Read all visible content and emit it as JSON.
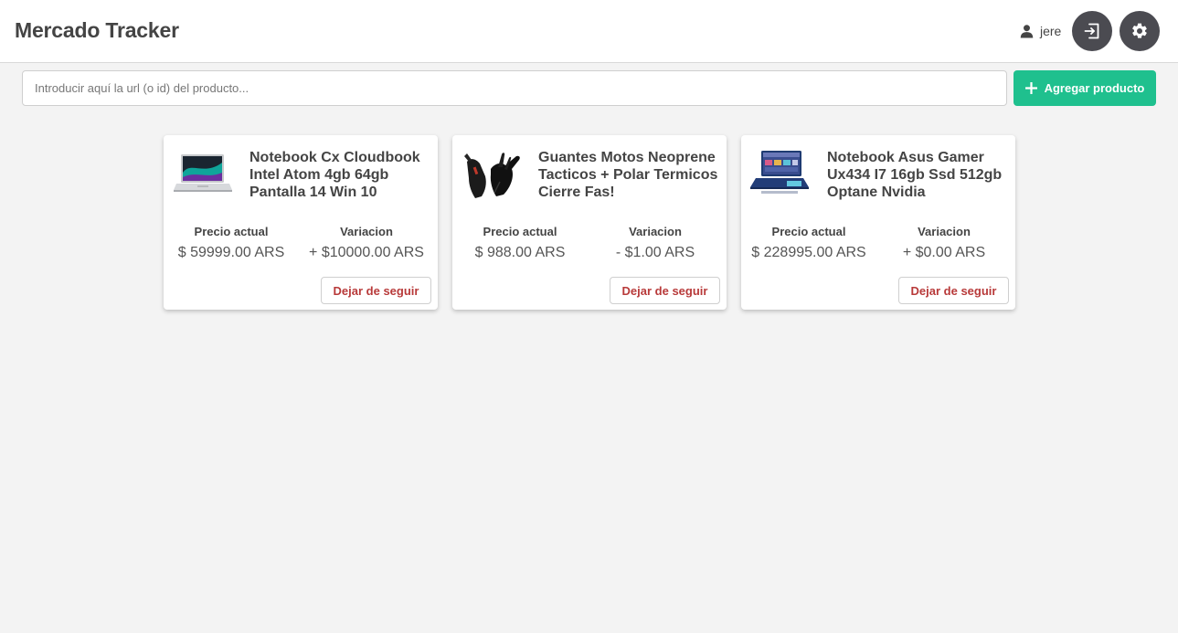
{
  "header": {
    "app_title": "Mercado Tracker",
    "username": "jere",
    "logout_icon": "logout-icon",
    "settings_icon": "gear-icon"
  },
  "search": {
    "placeholder": "Introducir aquí la url (o id) del producto...",
    "value": ""
  },
  "add_button": {
    "label": "Agregar producto",
    "icon": "plus-icon",
    "color": "#1fc08e"
  },
  "labels": {
    "current_price": "Precio actual",
    "variation": "Variacion",
    "unfollow": "Dejar de seguir"
  },
  "products": [
    {
      "title": "Notebook Cx Cloudbook Intel Atom 4gb 64gb Pantalla 14 Win 10",
      "price": "$ 59999.00 ARS",
      "variation": "+ $10000.00 ARS",
      "image": "laptop-silver"
    },
    {
      "title": "Guantes Motos Neoprene Tacticos + Polar Termicos Cierre Fas!",
      "price": "$ 988.00 ARS",
      "variation": "- $1.00 ARS",
      "image": "black-gloves"
    },
    {
      "title": "Notebook Asus Gamer Ux434 I7 16gb Ssd 512gb Optane Nvidia",
      "price": "$ 228995.00 ARS",
      "variation": "+ $0.00 ARS",
      "image": "laptop-blue"
    }
  ],
  "colors": {
    "accent": "#1fc08e",
    "dark_button": "#4b4b51",
    "danger_text": "#b83a3a",
    "background": "#f3f3f3"
  }
}
